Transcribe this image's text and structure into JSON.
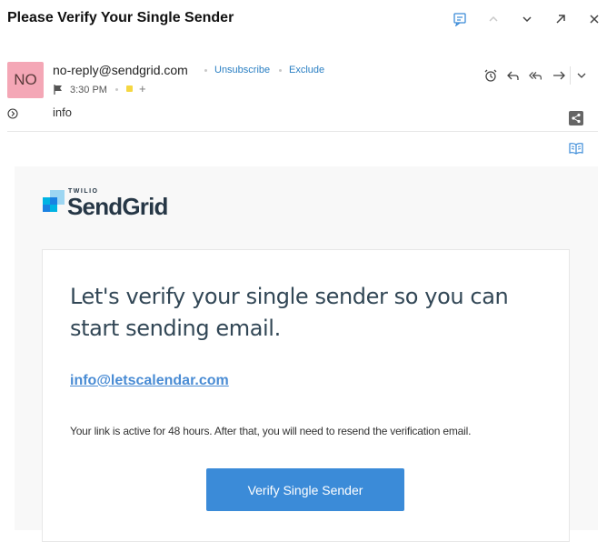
{
  "header": {
    "subject": "Please Verify Your Single Sender",
    "icons": [
      "chat-icon",
      "chevron-up-icon",
      "chevron-down-icon",
      "expand-icon",
      "close-icon"
    ]
  },
  "sender": {
    "avatar_initials": "NO",
    "avatar_color": "#f4a7b6",
    "email": "no-reply@sendgrid.com",
    "unsubscribe_label": "Unsubscribe",
    "exclude_label": "Exclude",
    "time": "3:30 PM",
    "tag_color": "#f5d742",
    "to": "info",
    "actions": [
      "alarm-icon",
      "reply-icon",
      "reply-all-icon",
      "forward-icon",
      "more-chevron-icon"
    ]
  },
  "email": {
    "logo_small": "TWILIO",
    "logo_brand": "SendGrid",
    "headline": "Let's verify your single sender so you can start sending email.",
    "link": "info@letscalendar.com",
    "notice": "Your link is active for 48 hours. After that, you will need to resend the verification email.",
    "button_label": "Verify Single Sender",
    "button_color": "#3b8bd8",
    "link_color": "#4a8cd4"
  }
}
